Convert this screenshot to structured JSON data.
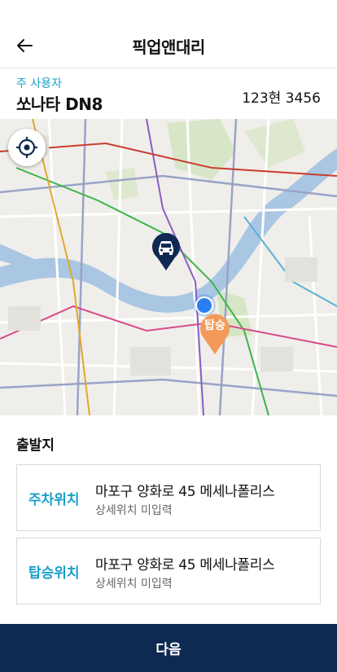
{
  "header": {
    "title": "픽업앤대리",
    "back_icon": "arrow-left-icon"
  },
  "vehicle": {
    "role": "주 사용자",
    "model": "쏘나타 DN8",
    "plate": "123현 3456"
  },
  "map": {
    "locate_icon": "crosshair-icon",
    "car_marker_icon": "car-icon",
    "pickup_marker_label": "탑승",
    "colors": {
      "river": "#a9c6e3",
      "pickup": "#f39a5a",
      "car": "#0f2a52",
      "current": "#2a7ff0"
    }
  },
  "departure": {
    "label": "출발지",
    "cards": [
      {
        "kind": "주차위치",
        "address": "마포구 양화로 45 메세나폴리스",
        "detail": "상세위치 미입력"
      },
      {
        "kind": "탑승위치",
        "address": "마포구 양화로 45 메세나폴리스",
        "detail": "상세위치 미입력"
      }
    ]
  },
  "footer": {
    "next_label": "다음",
    "color": "#0f2a52"
  }
}
